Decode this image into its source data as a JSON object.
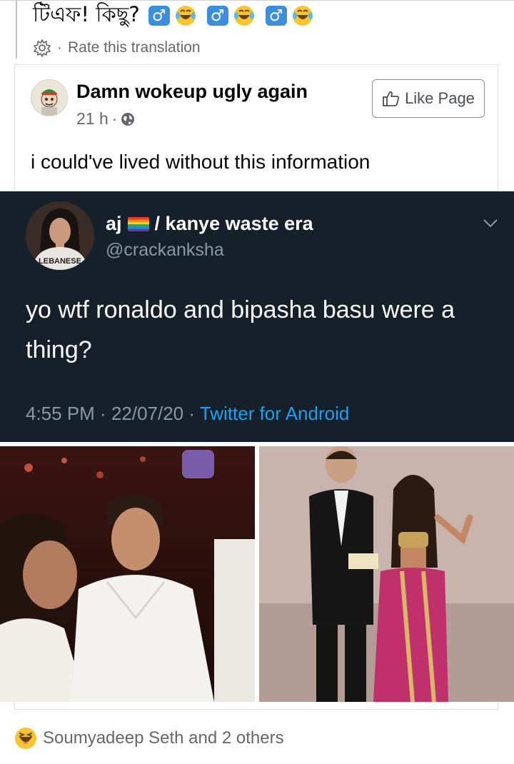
{
  "translated_line": {
    "text": "টিএফ! কিছু?",
    "emojis": [
      "male-sign",
      "laughing-tears",
      "male-sign",
      "laughing-tears",
      "male-sign",
      "laughing-tears"
    ],
    "male_sign": "♂"
  },
  "translation_bar": {
    "separator": "·",
    "rate_label": "Rate this translation"
  },
  "post": {
    "page_name": "Damn wokeup ugly again",
    "time": "21 h",
    "meta_separator": "·",
    "like_button_label": "Like Page",
    "caption": "i could've lived without this information"
  },
  "tweet": {
    "display_name_prefix": "aj",
    "display_name_suffix": "/ kanye waste era",
    "handle": "@crackanksha",
    "avatar_shirt_text": "LEBANESE",
    "text": "yo wtf ronaldo and bipasha basu were a thing?",
    "time": "4:55 PM",
    "sep1": " · ",
    "date": "22/07/20",
    "sep2": " · ",
    "source": "Twitter for Android",
    "background_color": "#15202b",
    "link_color": "#1da1f2"
  },
  "photos": [
    {
      "description_name": "photo-left-nightclub"
    },
    {
      "description_name": "photo-right-stage-event"
    }
  ],
  "reactions": {
    "icon": "haha-reaction-icon",
    "text": "Soumyadeep Seth and 2 others"
  }
}
